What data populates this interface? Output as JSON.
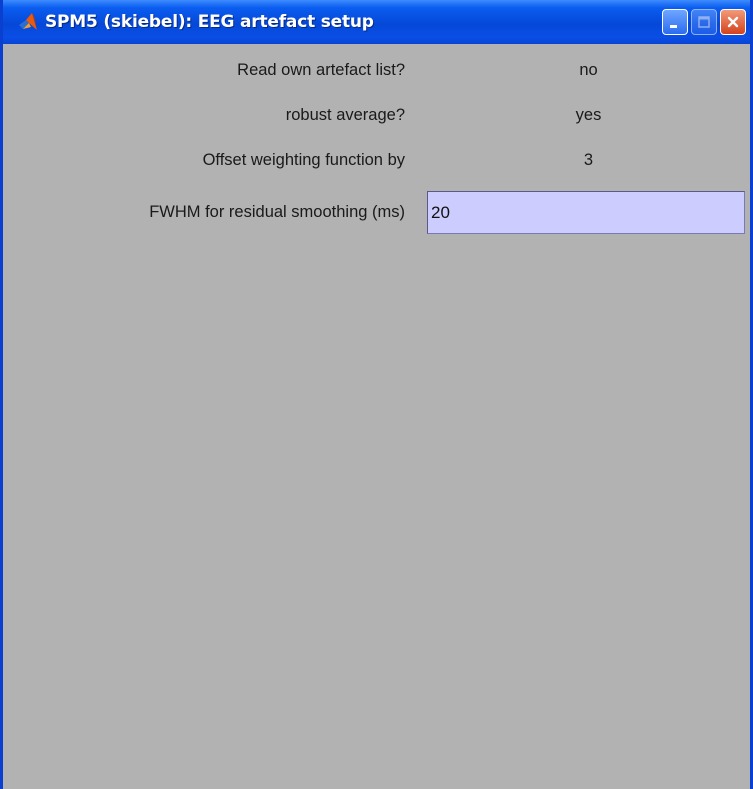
{
  "window": {
    "title": "SPM5 (skiebel): EEG artefact setup",
    "icon": "matlab-icon",
    "controls": {
      "minimize": "minimize-icon",
      "maximize": "maximize-icon",
      "close": "close-icon"
    }
  },
  "form": {
    "rows": [
      {
        "label": "Read own artefact list?",
        "value": "no"
      },
      {
        "label": "robust average?",
        "value": "yes"
      },
      {
        "label": "Offset weighting function by",
        "value": "3"
      },
      {
        "label": "FWHM for residual smoothing (ms)",
        "value": "20"
      }
    ]
  },
  "colors": {
    "client_background": "#b2b2b2",
    "edit_background": "#ccccff",
    "titlebar": "#0548d8"
  }
}
